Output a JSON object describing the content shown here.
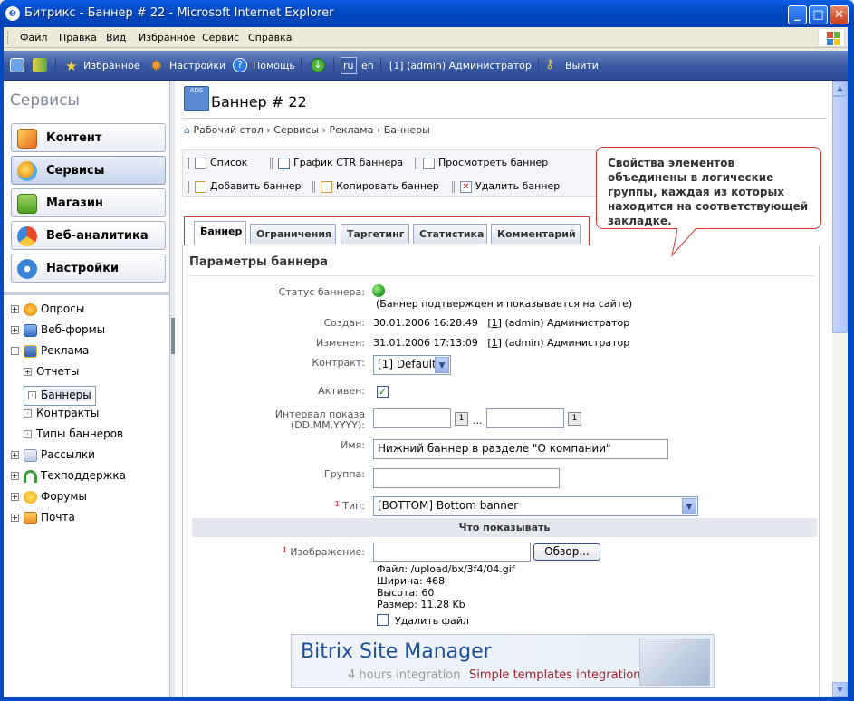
{
  "window": {
    "title": "Битрикс - Баннер # 22 - Microsoft Internet Explorer",
    "min": "_",
    "max": "□",
    "close": "✕"
  },
  "menu": [
    "Файл",
    "Правка",
    "Вид",
    "Избранное",
    "Сервис",
    "Справка"
  ],
  "adminbar": {
    "favorites": "Избранное",
    "settings": "Настройки",
    "help": "Помощь",
    "lang_ru": "ru",
    "lang_en": "en",
    "user": "[1] (admin) Администратор",
    "logout": "Выйти"
  },
  "sidebar": {
    "title": "Сервисы",
    "buttons": [
      "Контент",
      "Сервисы",
      "Магазин",
      "Веб-аналитика",
      "Настройки"
    ],
    "tree": [
      {
        "label": "Опросы",
        "pm": "+"
      },
      {
        "label": "Веб-формы",
        "pm": "+"
      },
      {
        "label": "Реклама",
        "pm": "−"
      },
      {
        "label": "Отчеты",
        "pm": "+"
      },
      {
        "label": "Баннеры",
        "pm": "·"
      },
      {
        "label": "Контракты",
        "pm": "·"
      },
      {
        "label": "Типы баннеров",
        "pm": "·"
      },
      {
        "label": "Рассылки",
        "pm": "+"
      },
      {
        "label": "Техподдержка",
        "pm": "+"
      },
      {
        "label": "Форумы",
        "pm": "+"
      },
      {
        "label": "Почта",
        "pm": "+"
      }
    ]
  },
  "page": {
    "title": "Баннер # 22",
    "icon_text": "ADS",
    "breadcrumb": "Рабочий стол › Сервисы › Реклама › Баннеры",
    "toolbar": [
      "Список",
      "График CTR баннера",
      "Просмотреть баннер",
      "Добавить баннер",
      "Копировать баннер",
      "Удалить баннер"
    ],
    "tabs": [
      "Баннер",
      "Ограничения",
      "Таргетинг",
      "Статистика",
      "Комментарий"
    ],
    "section": "Параметры баннера",
    "fields": {
      "status_label": "Статус баннера:",
      "status_text": "(Баннер подтвержден и показывается на сайте)",
      "created_label": "Создан:",
      "created_date": "30.01.2006 16:28:49",
      "created_user_id": "1",
      "created_user": "(admin) Администратор",
      "modified_label": "Изменен:",
      "modified_date": "31.01.2006 17:13:09",
      "modified_user_id": "1",
      "modified_user": "(admin) Администратор",
      "contract_label": "Контракт:",
      "contract_value": "[1] Default",
      "active_label": "Активен:",
      "interval_label1": "Интервал показа",
      "interval_label2": "(DD.MM.YYYY):",
      "interval_sep": "...",
      "name_label": "Имя:",
      "name_value": "Нижний баннер в разделе \"О компании\"",
      "group_label": "Группа:",
      "type_label": "Тип:",
      "type_value": "[BOTTOM] Bottom banner",
      "section2": "Что показывать",
      "image_label": "Изображение:",
      "browse": "Обзор...",
      "file": "Файл: /upload/bx/3f4/04.gif",
      "width": "Ширина: 468",
      "height": "Высота: 60",
      "size": "Размер: 11.28 Kb",
      "delete_file": "Удалить файл",
      "required_mark": "1"
    },
    "banner": {
      "line1": "Bitrix Site Manager",
      "line2a": "4 hours integration",
      "line2b": "Simple templates integration"
    }
  },
  "callout": "Свойства элементов объединены в логические группы, каждая из которых находится на соответствующей закладке.",
  "colors": {
    "accent": "#0349C4",
    "callout_border": "#D0342C",
    "status_green": "#2DA52D"
  }
}
